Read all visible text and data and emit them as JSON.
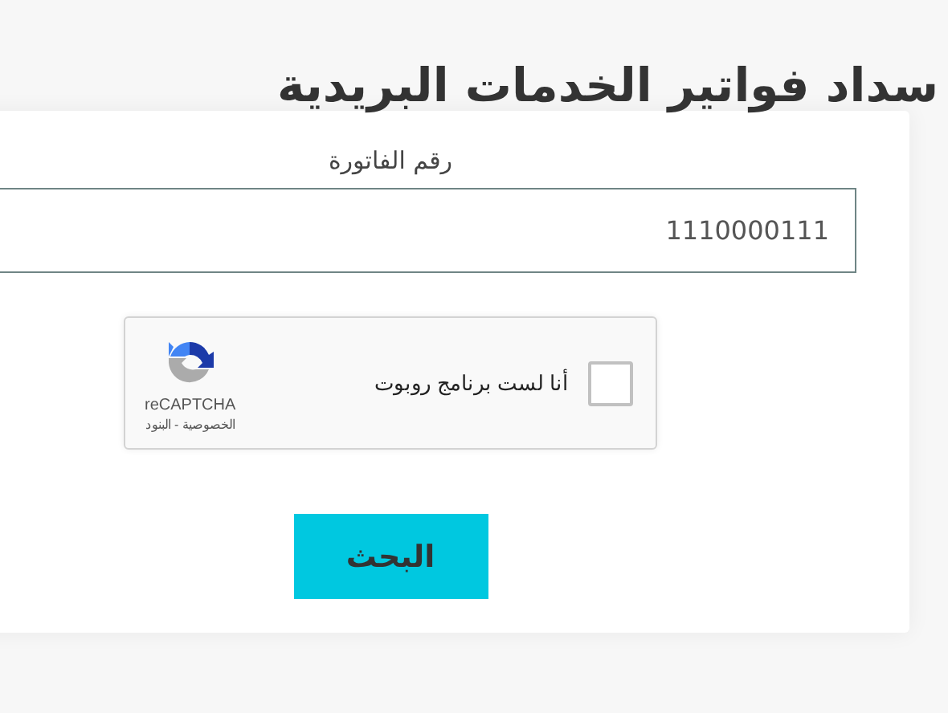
{
  "title": "سداد فواتير الخدمات البريدية",
  "invoice_field": {
    "label": "رقم الفاتورة",
    "value": "1110000111"
  },
  "captcha": {
    "label": "أنا لست برنامج روبوت",
    "checked": false,
    "brand": "reCAPTCHA",
    "links": "الخصوصية - البنود"
  },
  "search_button": "البحث"
}
